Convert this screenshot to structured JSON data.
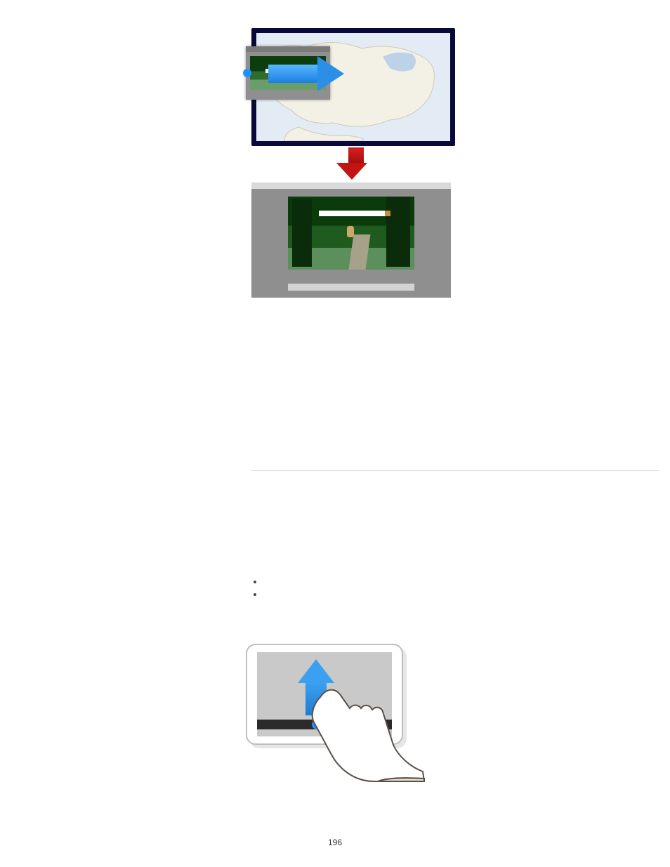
{
  "page_number": "196",
  "figure1": {
    "alt_top": "TV screen showing map with inset photo dragged right",
    "alt_bottom": "PC window showing enlarged forest-path photo"
  },
  "separator": "",
  "section2": {
    "bullets": [
      "",
      ""
    ]
  },
  "figure2": {
    "alt": "Tablet with finger swiping up from bottom edge"
  }
}
